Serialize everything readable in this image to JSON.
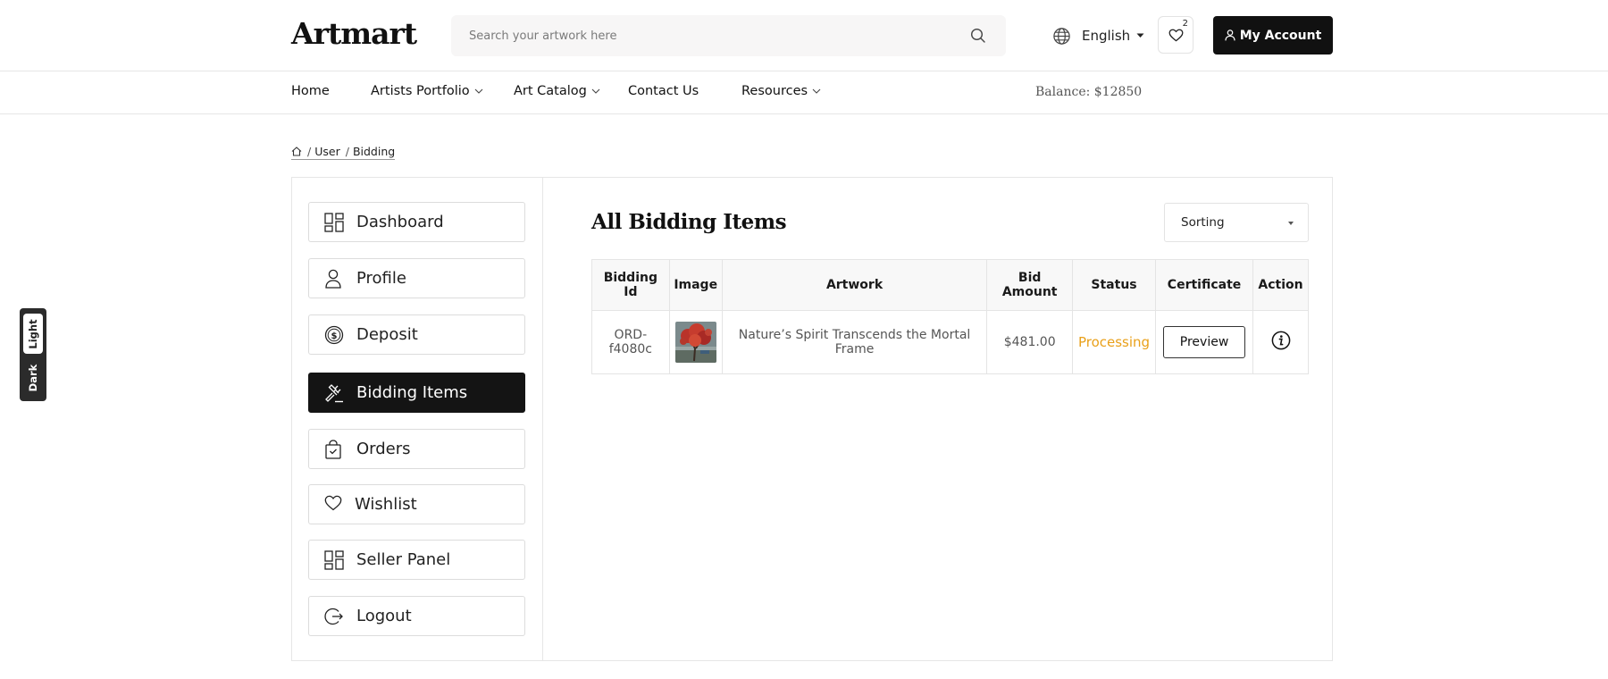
{
  "brand": {
    "logo_text": "Artmart"
  },
  "search": {
    "placeholder": "Search your artwork here"
  },
  "language": {
    "label": "English"
  },
  "wishlist": {
    "count": "2"
  },
  "account": {
    "label": "My Account"
  },
  "nav": {
    "items": [
      {
        "label": "Home",
        "has_dropdown": false
      },
      {
        "label": "Artists Portfolio",
        "has_dropdown": true
      },
      {
        "label": "Art Catalog",
        "has_dropdown": true
      },
      {
        "label": "Contact Us",
        "has_dropdown": false
      },
      {
        "label": "Resources",
        "has_dropdown": true
      }
    ],
    "balance": "Balance: $12850"
  },
  "breadcrumb": {
    "home_icon": "home-icon",
    "items": [
      "User",
      "Bidding"
    ]
  },
  "sidebar": {
    "items": [
      {
        "label": "Dashboard",
        "icon": "grid-icon",
        "active": false
      },
      {
        "label": "Profile",
        "icon": "user-icon",
        "active": false
      },
      {
        "label": "Deposit",
        "icon": "dollar-coin-icon",
        "active": false
      },
      {
        "label": "Bidding Items",
        "icon": "gavel-icon",
        "active": true
      },
      {
        "label": "Orders",
        "icon": "shopping-bag-icon",
        "active": false
      },
      {
        "label": "Wishlist",
        "icon": "heart-icon",
        "active": false
      },
      {
        "label": "Seller Panel",
        "icon": "grid-icon",
        "active": false
      },
      {
        "label": "Logout",
        "icon": "logout-icon",
        "active": false
      }
    ]
  },
  "main": {
    "title": "All Bidding Items",
    "sort": {
      "label": "Sorting"
    },
    "table": {
      "headers": [
        "Bidding Id",
        "Image",
        "Artwork",
        "Bid Amount",
        "Status",
        "Certificate",
        "Action"
      ],
      "rows": [
        {
          "bidding_id": "ORD-f4080c",
          "image_icon": "artwork-thumbnail",
          "artwork": "Nature’s Spirit Transcends the Mortal Frame",
          "bid_amount": "$481.00",
          "status": "Processing",
          "certificate_label": "Preview",
          "action_icon": "info-icon"
        }
      ]
    }
  },
  "theme_toggle": {
    "light_label": "Light",
    "dark_label": "Dark"
  },
  "colors": {
    "accent_dark": "#141414",
    "status_processing": "#e9a01a",
    "border": "#e6e6e6"
  }
}
